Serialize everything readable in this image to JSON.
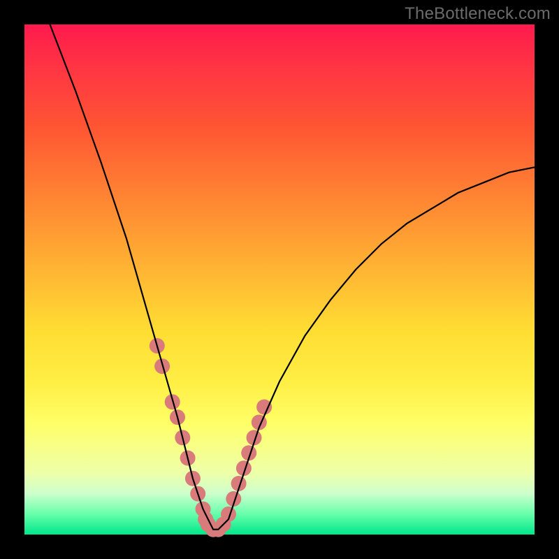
{
  "watermark": "TheBottleneck.com",
  "chart_data": {
    "type": "line",
    "title": "",
    "xlabel": "",
    "ylabel": "",
    "xlim": [
      0,
      100
    ],
    "ylim": [
      0,
      100
    ],
    "series": [
      {
        "name": "bottleneck-curve",
        "x": [
          5,
          10,
          15,
          20,
          22,
          24,
          26,
          28,
          30,
          32,
          33,
          34,
          35,
          36,
          37,
          38,
          40,
          42,
          44,
          46,
          50,
          55,
          60,
          65,
          70,
          75,
          80,
          85,
          90,
          95,
          100
        ],
        "values": [
          100,
          87,
          73,
          58,
          51,
          44,
          37,
          30,
          23,
          15,
          11,
          8,
          5,
          3,
          1,
          1,
          3,
          9,
          15,
          21,
          30,
          39,
          46,
          52,
          57,
          61,
          64,
          67,
          69,
          71,
          72
        ]
      }
    ],
    "markers": {
      "name": "highlighted-points",
      "color": "#d97b7b",
      "points": [
        {
          "x": 26,
          "y": 37
        },
        {
          "x": 27,
          "y": 33
        },
        {
          "x": 29,
          "y": 26
        },
        {
          "x": 30,
          "y": 23
        },
        {
          "x": 31,
          "y": 19
        },
        {
          "x": 32,
          "y": 15
        },
        {
          "x": 33,
          "y": 11
        },
        {
          "x": 34,
          "y": 8
        },
        {
          "x": 35,
          "y": 5
        },
        {
          "x": 35.5,
          "y": 3
        },
        {
          "x": 36,
          "y": 2
        },
        {
          "x": 37,
          "y": 1
        },
        {
          "x": 38,
          "y": 1
        },
        {
          "x": 39,
          "y": 2
        },
        {
          "x": 40,
          "y": 4
        },
        {
          "x": 41,
          "y": 7
        },
        {
          "x": 42,
          "y": 10
        },
        {
          "x": 43,
          "y": 13
        },
        {
          "x": 44,
          "y": 16
        },
        {
          "x": 45,
          "y": 19
        },
        {
          "x": 46,
          "y": 22
        },
        {
          "x": 47,
          "y": 25
        }
      ]
    }
  }
}
